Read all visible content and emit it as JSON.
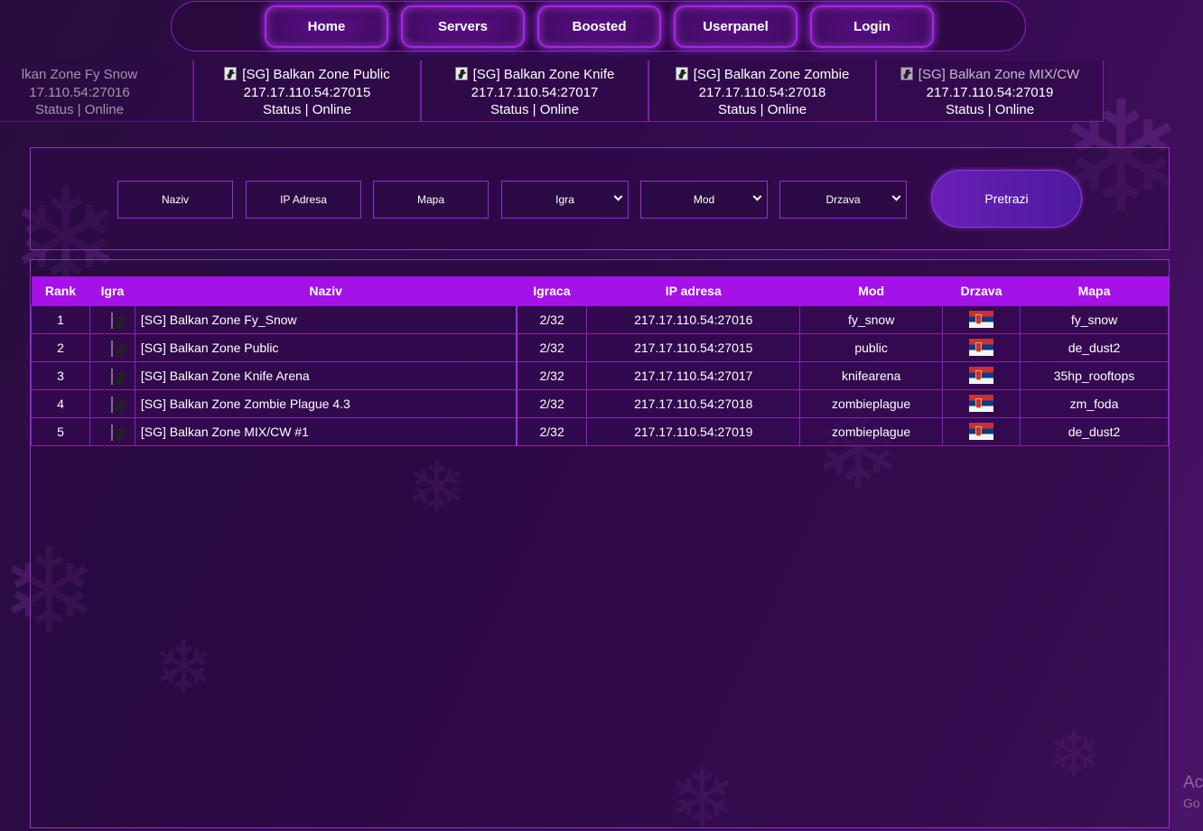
{
  "nav": {
    "items": [
      {
        "label": "Home"
      },
      {
        "label": "Servers"
      },
      {
        "label": "Boosted"
      },
      {
        "label": "Userpanel"
      },
      {
        "label": "Login"
      }
    ]
  },
  "ticker": {
    "cards": [
      {
        "name": "lkan Zone Fy  Snow",
        "ip": "17.110.54:27016",
        "status": "Status | Online"
      },
      {
        "name": "[SG] Balkan Zone Public",
        "ip": "217.17.110.54:27015",
        "status": "Status | Online"
      },
      {
        "name": "[SG] Balkan Zone Knife",
        "ip": "217.17.110.54:27017",
        "status": "Status | Online"
      },
      {
        "name": "[SG] Balkan Zone Zombie",
        "ip": "217.17.110.54:27018",
        "status": "Status | Online"
      },
      {
        "name": "[SG] Balkan Zone MIX/CW",
        "ip": "217.17.110.54:27019",
        "status": "Status | Online"
      }
    ]
  },
  "search": {
    "naziv_placeholder": "Naziv",
    "ip_placeholder": "IP Adresa",
    "mapa_placeholder": "Mapa",
    "igra_label": "Igra",
    "mod_label": "Mod",
    "drzava_label": "Drzava",
    "button_label": "Pretrazi"
  },
  "table": {
    "headers": {
      "rank": "Rank",
      "igra": "Igra",
      "naziv": "Naziv",
      "igraca": "Igraca",
      "ip": "IP adresa",
      "mod": "Mod",
      "drzava": "Drzava",
      "mapa": "Mapa"
    },
    "rows": [
      {
        "rank": "1",
        "naziv": "[SG] Balkan Zone Fy_Snow",
        "igraca": "2/32",
        "ip": "217.17.110.54:27016",
        "mod": "fy_snow",
        "mapa": "fy_snow"
      },
      {
        "rank": "2",
        "naziv": "[SG] Balkan Zone Public",
        "igraca": "2/32",
        "ip": "217.17.110.54:27015",
        "mod": "public",
        "mapa": "de_dust2"
      },
      {
        "rank": "3",
        "naziv": "[SG] Balkan Zone Knife Arena",
        "igraca": "2/32",
        "ip": "217.17.110.54:27017",
        "mod": "knifearena",
        "mapa": "35hp_rooftops"
      },
      {
        "rank": "4",
        "naziv": "[SG] Balkan Zone Zombie Plague 4.3",
        "igraca": "2/32",
        "ip": "217.17.110.54:27018",
        "mod": "zombieplague",
        "mapa": "zm_foda"
      },
      {
        "rank": "5",
        "naziv": "[SG] Balkan Zone MIX/CW #1",
        "igraca": "2/32",
        "ip": "217.17.110.54:27019",
        "mod": "zombieplague",
        "mapa": "de_dust2"
      }
    ]
  },
  "watermark": {
    "line1": "Ac",
    "line2": "Go"
  },
  "colors": {
    "accent": "#a412e8",
    "border": "#9a2bd6",
    "background": "#2f0b4a"
  }
}
